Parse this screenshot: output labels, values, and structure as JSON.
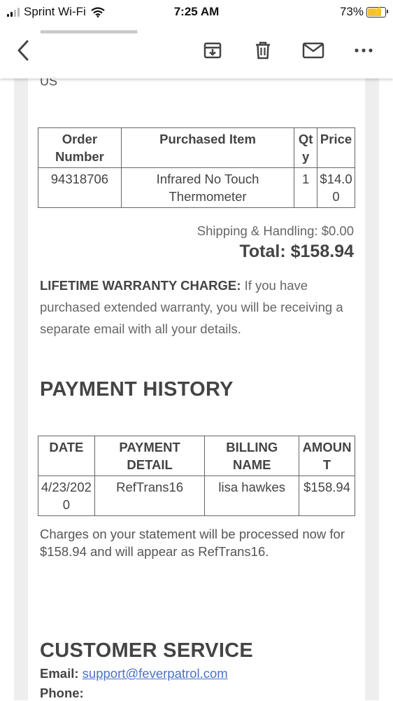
{
  "status_bar": {
    "carrier": "Sprint Wi-Fi",
    "time": "7:25 AM",
    "battery": "73%"
  },
  "toolbar": {
    "back_icon": "chevron-left-icon",
    "archive_icon": "archive-icon",
    "delete_icon": "trash-icon",
    "mail_icon": "mail-icon",
    "more_icon": "more-icon"
  },
  "address": {
    "country": "US"
  },
  "order_table": {
    "headers": [
      "Order Number",
      "Purchased Item",
      "Qty",
      "Price"
    ],
    "rows": [
      [
        "94318706",
        "Infrared No Touch Thermometer",
        "1",
        "$14.00"
      ]
    ]
  },
  "summary": {
    "shipping": "Shipping & Handling: $0.00",
    "total": "Total: $158.94"
  },
  "warranty": {
    "label": "LIFETIME WARRANTY CHARGE:",
    "text": "If you have purchased extended warranty, you will be receiving a separate email with all your details."
  },
  "payment_history": {
    "heading": "PAYMENT HISTORY",
    "headers": [
      "DATE",
      "PAYMENT DETAIL",
      "BILLING NAME",
      "AMOUNT"
    ],
    "rows": [
      [
        "4/23/2020",
        "RefTrans16",
        "lisa hawkes",
        "$158.94"
      ]
    ]
  },
  "charges_note": "Charges on your statement will be processed now for $158.94 and will appear as RefTrans16.",
  "customer_service": {
    "heading": "CUSTOMER SERVICE",
    "email_label": "Email:",
    "email": "support@feverpatrol.com",
    "phone_label": "Phone:"
  },
  "colors": {
    "link": "#4a72c8",
    "battery_fill": "#f2c230"
  }
}
